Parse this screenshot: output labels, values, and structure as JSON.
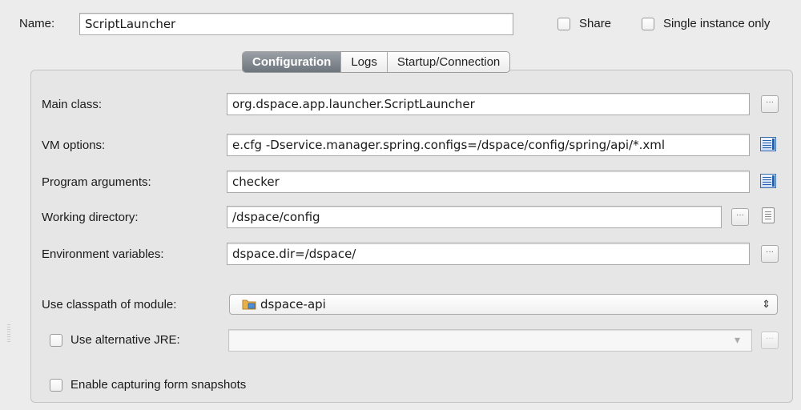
{
  "header": {
    "name_label": "Name:",
    "name_value": "ScriptLauncher",
    "share_label": "Share",
    "single_instance_label": "Single instance only"
  },
  "tabs": [
    {
      "label": "Configuration",
      "active": true
    },
    {
      "label": "Logs",
      "active": false
    },
    {
      "label": "Startup/Connection",
      "active": false
    }
  ],
  "form": {
    "main_class": {
      "label": "Main class:",
      "value": "org.dspace.app.launcher.ScriptLauncher"
    },
    "vm_options": {
      "label": "VM options:",
      "value": "e.cfg -Dservice.manager.spring.configs=/dspace/config/spring/api/*.xml"
    },
    "program_arguments": {
      "label": "Program arguments:",
      "value": "checker"
    },
    "working_directory": {
      "label": "Working directory:",
      "value": "/dspace/config"
    },
    "environment_variables": {
      "label": "Environment variables:",
      "value": "dspace.dir=/dspace/"
    },
    "classpath_module": {
      "label": "Use classpath of module:",
      "value": "dspace-api"
    },
    "alternative_jre": {
      "label": "Use alternative JRE:",
      "value": ""
    },
    "capture_snapshots": {
      "label": "Enable capturing form snapshots"
    }
  },
  "icons": {
    "browse": "ellipsis-button",
    "expand": "expand-editor-icon",
    "file": "file-icon",
    "module": "module-folder-icon",
    "stepper": "select-arrows-icon",
    "dropdown": "dropdown-arrow-icon"
  },
  "glyphs": {
    "dots": "···",
    "updown": "⇕",
    "down": "▾"
  }
}
